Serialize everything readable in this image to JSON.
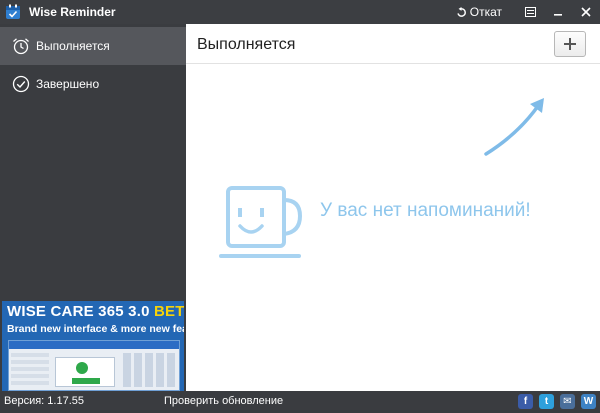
{
  "app": {
    "title": "Wise Reminder"
  },
  "titlebar": {
    "rollback_label": "Откат"
  },
  "sidebar": {
    "items": [
      {
        "label": "Выполняется",
        "icon": "alarm-clock-icon",
        "active": true
      },
      {
        "label": "Завершено",
        "icon": "check-circle-icon",
        "active": false
      }
    ]
  },
  "ad": {
    "title_main": "WISE CARE 365 3.0 ",
    "title_beta": "BETA",
    "subtitle": "Brand new interface & more new features"
  },
  "main": {
    "title": "Выполняется",
    "empty_message": "У вас нет напоминаний!"
  },
  "statusbar": {
    "version": "Версия: 1.17.55",
    "check_update": "Проверить обновление"
  },
  "socials": [
    {
      "glyph": "f",
      "icon": "facebook-icon",
      "color": "#3b5ca8"
    },
    {
      "glyph": "t",
      "icon": "twitter-icon",
      "color": "#2ea0dc"
    },
    {
      "glyph": "✉",
      "icon": "email-icon",
      "color": "#4a6e9a"
    },
    {
      "glyph": "W",
      "icon": "wise-icon",
      "color": "#3d82c4"
    }
  ],
  "colors": {
    "accent_light_blue": "#8ec6ec",
    "sidebar_bg": "#3a3c40",
    "sidebar_active": "#55575c",
    "ad_bg": "#2367b4",
    "beta_yellow": "#f6d20a"
  }
}
